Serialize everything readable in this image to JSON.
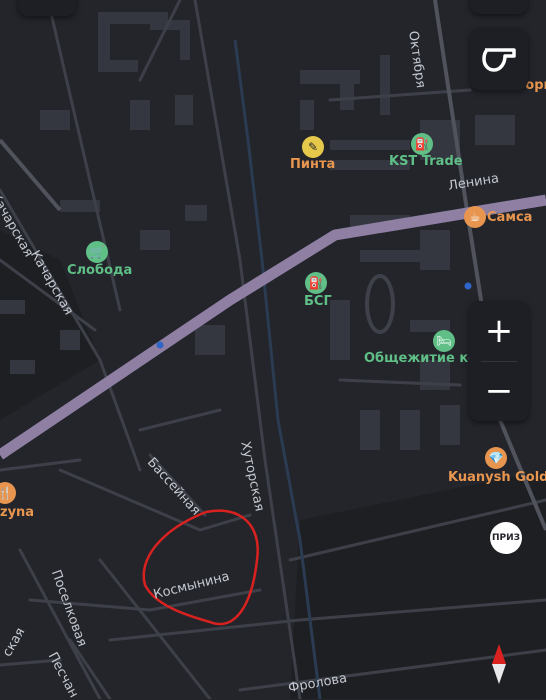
{
  "streets": {
    "lenina": "Ленина",
    "oktyabrya": "Октября",
    "kachar1": "Качарская",
    "kachar2": "Качарская",
    "basseynaya": "Бассейная",
    "khutorskaya": "Хуторская",
    "kosmynina": "Космынина",
    "poselkovaya": "Поселковая",
    "peschanaya": "Песчан",
    "frolova": "Фролова",
    "edge_ska": "ская"
  },
  "pois": {
    "pinta": "Пинта",
    "kst": "KST Trade",
    "samsa": "Самса",
    "sloboda": "Слобода",
    "bsg": "БСГ",
    "obshchezhitie": "Общежитие кс",
    "kuanysh": "Kuanysh Gold",
    "zyna": "zyna",
    "gork": "Горк"
  },
  "badge": "ПРИЗ",
  "colors": {
    "background": "#23252b",
    "main_road": "#8e7fa3",
    "poi_green": "#5fbf86",
    "poi_orange": "#e8964f",
    "annotation": "#d9221f"
  },
  "controls": {
    "zoom_in": "+",
    "zoom_out": "−",
    "top_icon": "map-layers-icon",
    "compass": "compass-icon"
  }
}
